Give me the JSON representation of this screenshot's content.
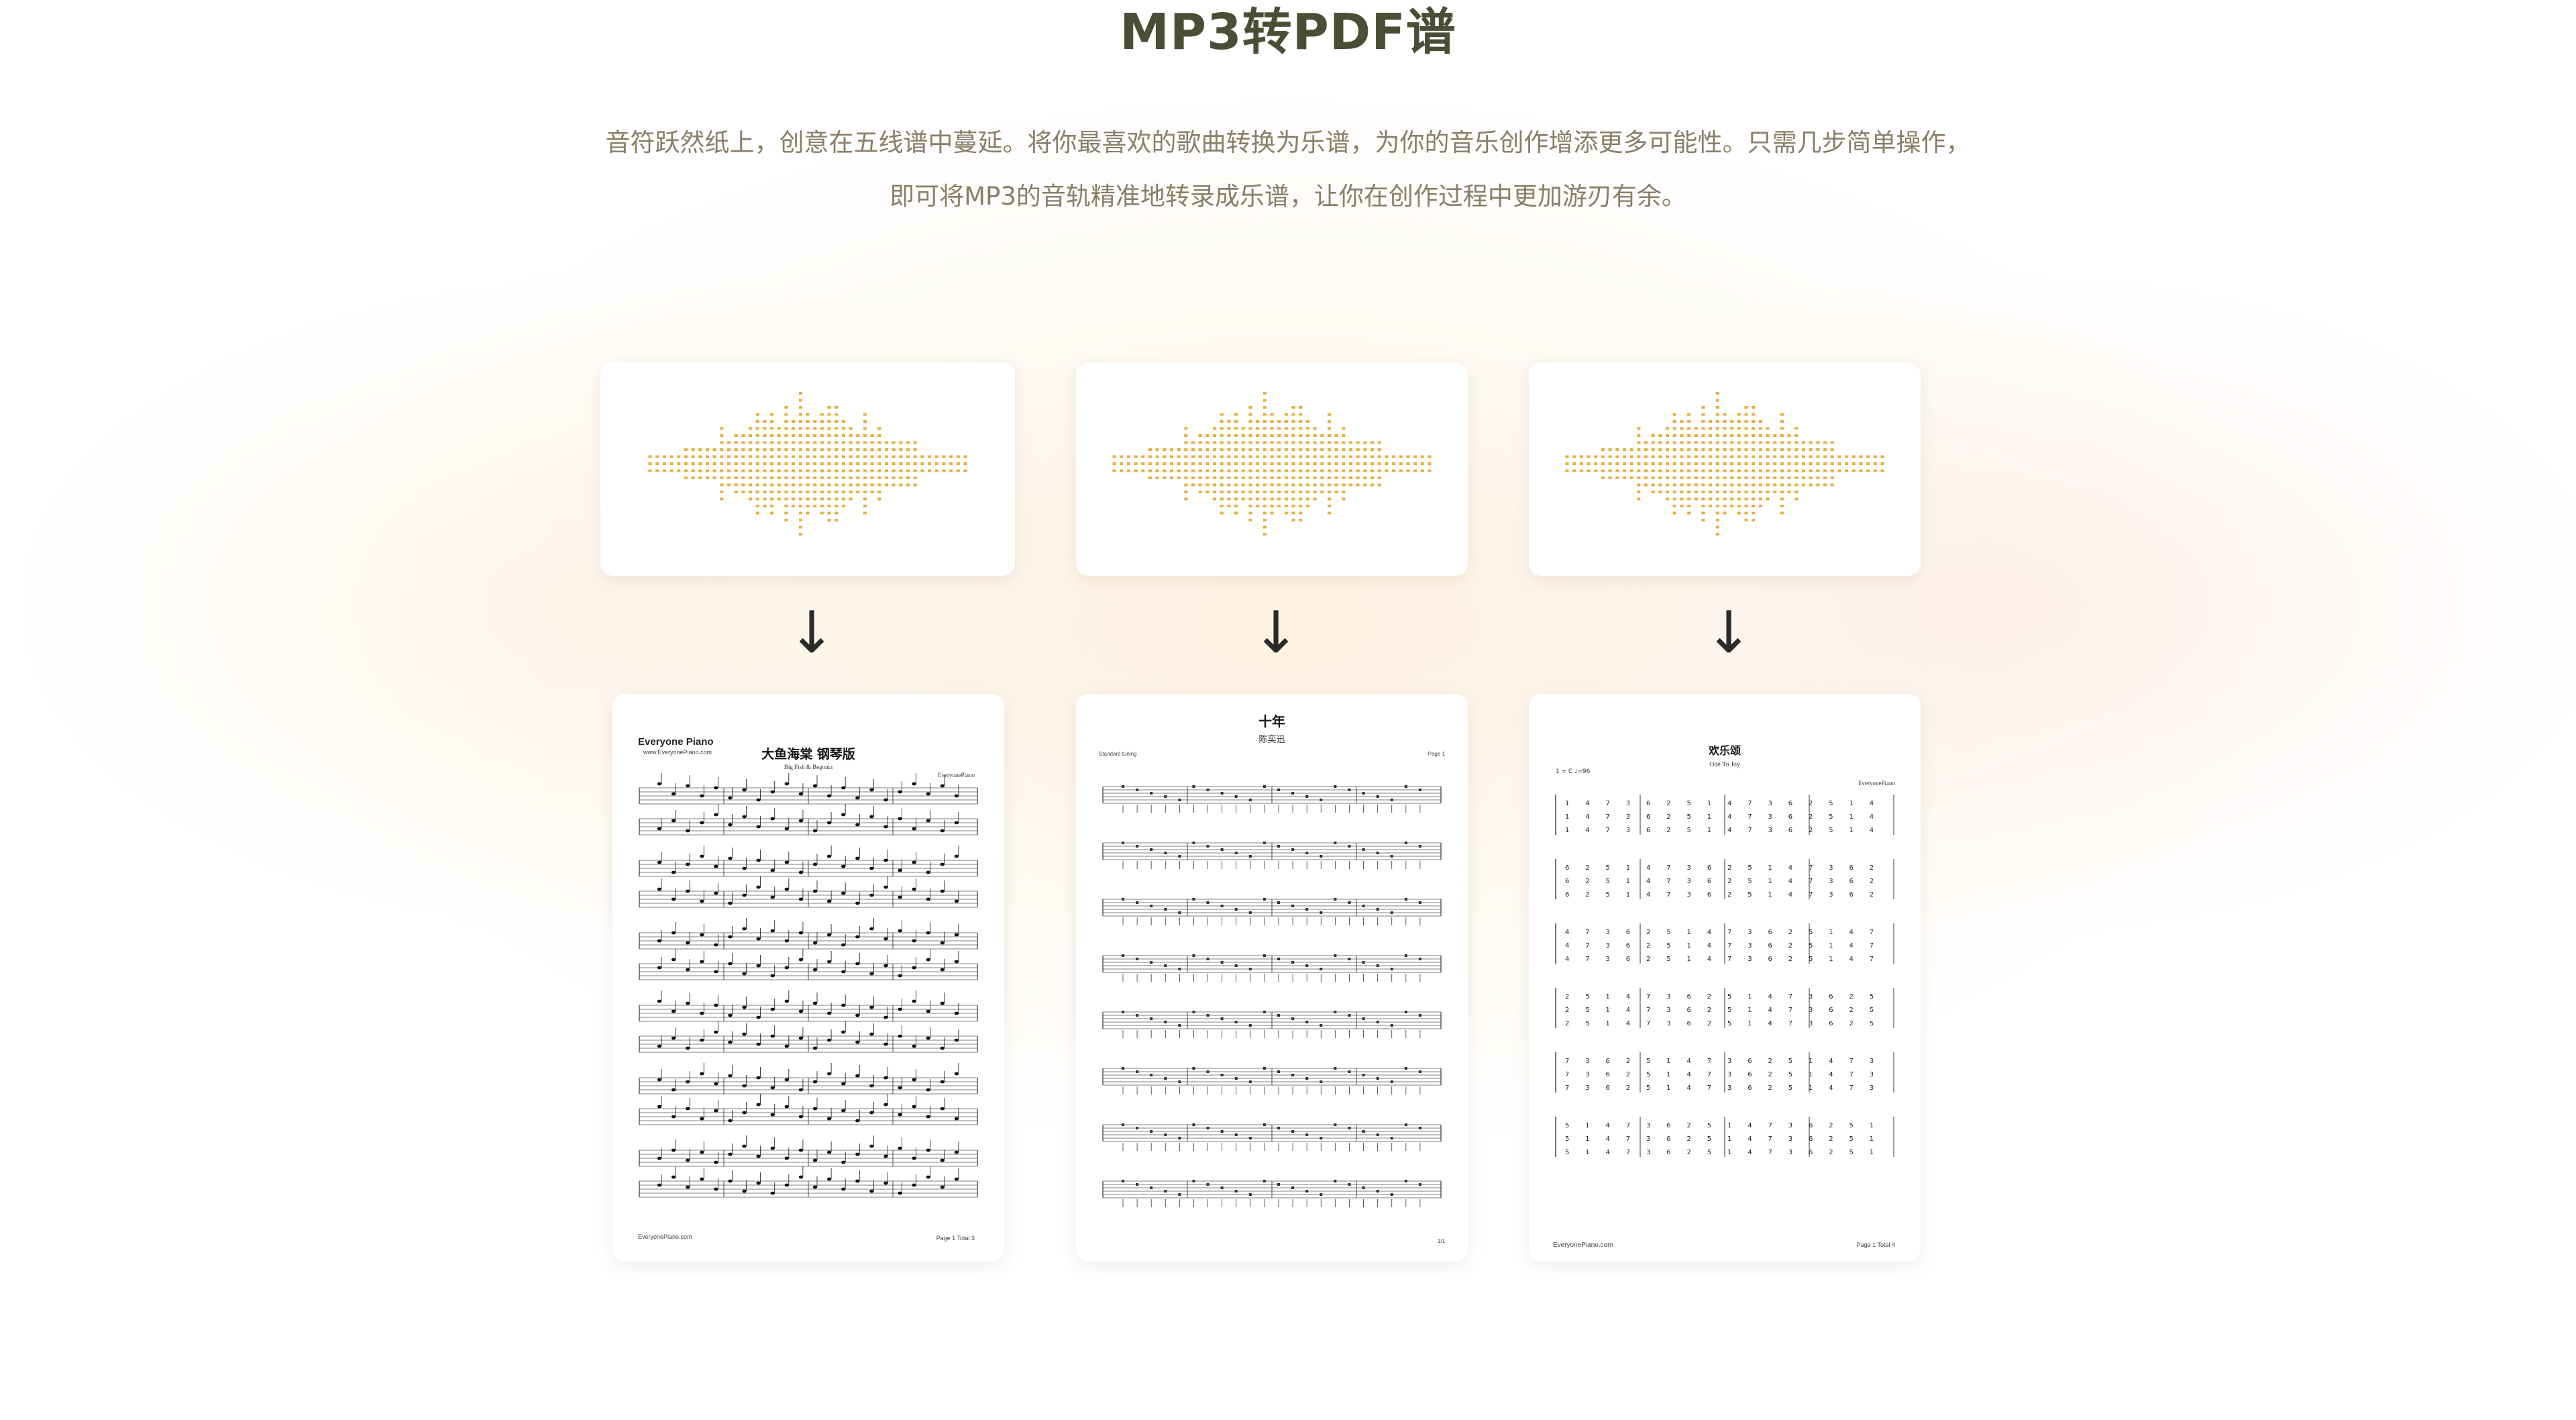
{
  "section": {
    "title": "MP3转PDF谱",
    "subtitle_line1": "音符跃然纸上，创意在五线谱中蔓延。将你最喜欢的歌曲转换为乐谱，为你的音乐创作增添更多可能性。只需几步简单操作，",
    "subtitle_line2": "即可将MP3的音轨精准地转录成乐谱，让你在创作过程中更加游刃有余。"
  },
  "colors": {
    "title": "#4a4e35",
    "subtitle": "#8b7e66",
    "waveform": "#e8ad3c",
    "arrow": "#2a2a2a"
  },
  "arrow_icon": "arrow-down-icon",
  "scores": [
    {
      "brand": "Everyone Piano",
      "brand_url": "www.EveryonePiano.com",
      "title": "大鱼海棠 钢琴版",
      "subtitle": "Big Fish & Begonia",
      "arranger": "EveryonePiano",
      "footer_left": "EveryonePiano.com",
      "footer_right": "Page 1 Total 3"
    },
    {
      "title": "十年",
      "subtitle": "陈奕迅",
      "header_left": "Standard tuning",
      "header_right": "Page 1",
      "footer_right": "1/1"
    },
    {
      "title": "欢乐颂",
      "subtitle": "Ode To Joy",
      "arranger": "EveryonePiano",
      "tempo": "1 = C  ♩=96",
      "footer_left": "EveryonePiano.com",
      "footer_right": "Page 1 Total 4"
    }
  ]
}
